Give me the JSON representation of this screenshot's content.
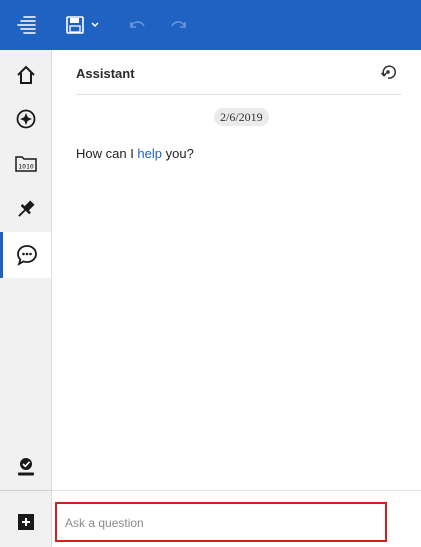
{
  "colors": {
    "topbar": "#1f62c1",
    "accent": "#1f62c1",
    "highlight_border": "#d21f1f"
  },
  "toolbar": {
    "icons": [
      "menu-icon",
      "save-icon",
      "chevron-down-icon",
      "undo-icon",
      "redo-icon"
    ]
  },
  "sidebar": {
    "items": [
      {
        "name": "home",
        "icon": "home-icon"
      },
      {
        "name": "navigate",
        "icon": "compass-icon"
      },
      {
        "name": "data",
        "icon": "data-icon"
      },
      {
        "name": "pinned",
        "icon": "pin-icon"
      },
      {
        "name": "assistant",
        "icon": "assistant-chat-icon",
        "active": true
      },
      {
        "name": "profile",
        "icon": "profile-icon"
      },
      {
        "name": "new",
        "icon": "plus-icon"
      }
    ]
  },
  "assistant": {
    "title": "Assistant",
    "date": "2/6/2019",
    "greeting_prefix": "How can I ",
    "greeting_link": "help",
    "greeting_suffix": " you?"
  },
  "input": {
    "placeholder": "Ask a question"
  }
}
